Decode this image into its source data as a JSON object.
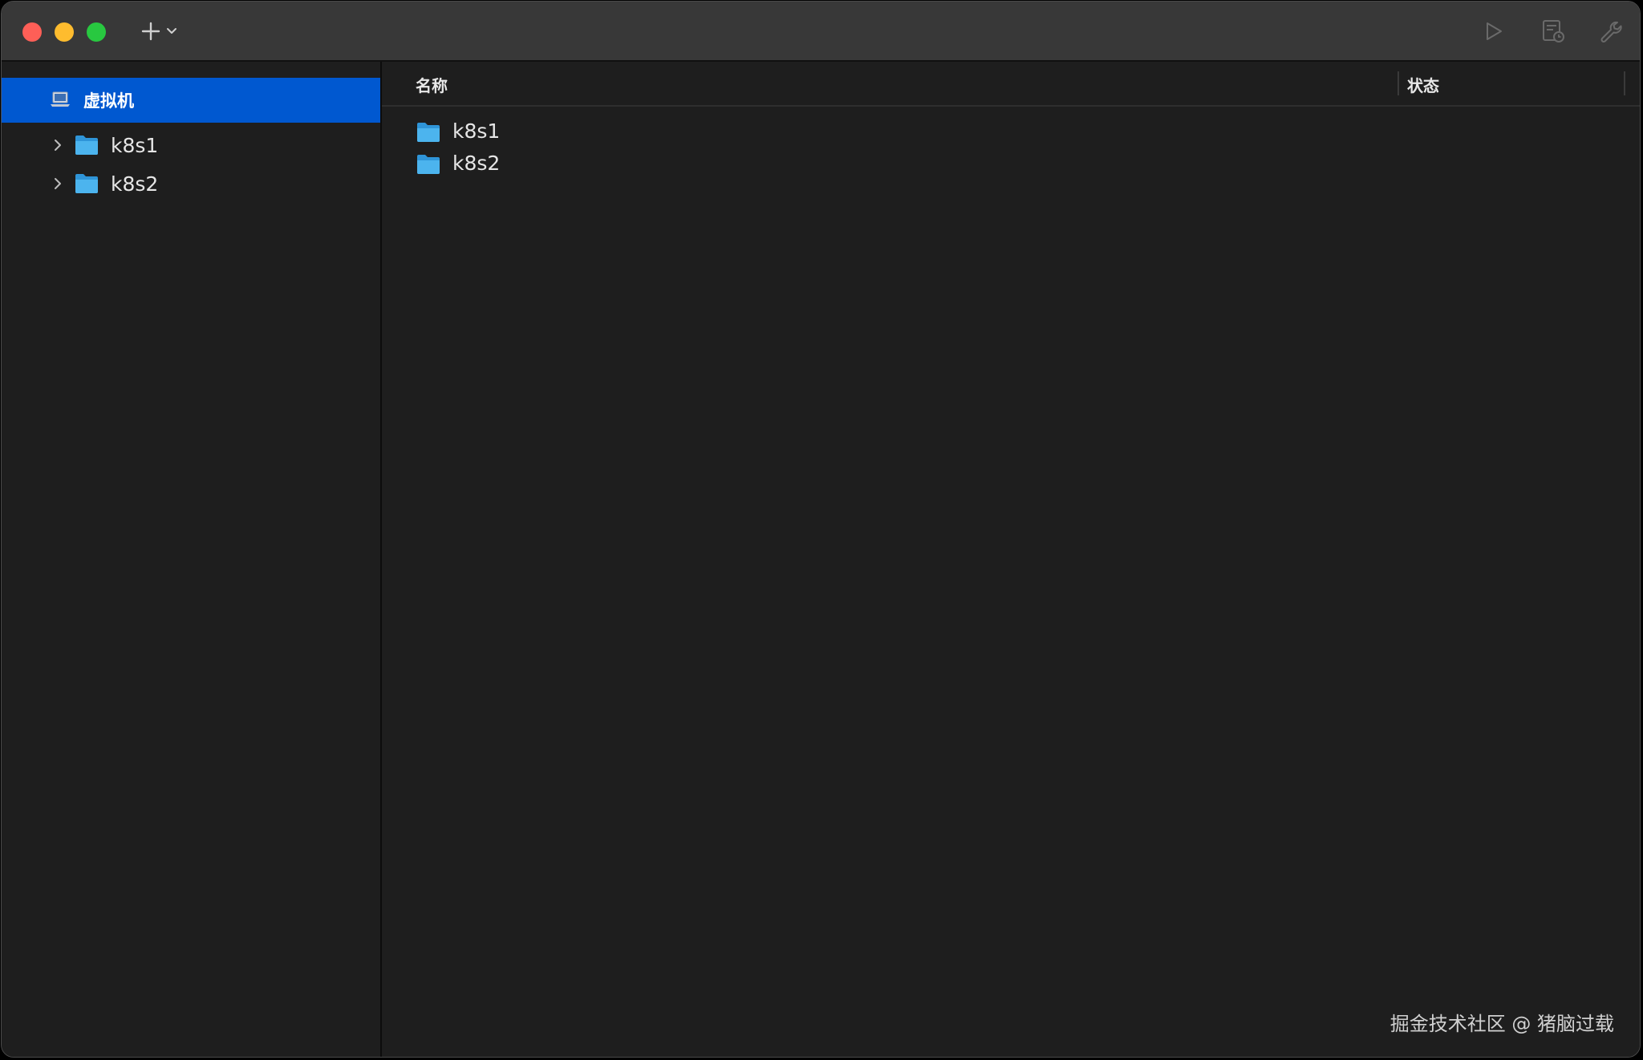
{
  "toolbar": {
    "add_icon": "plus-icon",
    "add_dropdown_icon": "chevron-down-icon",
    "start_icon": "play-icon",
    "snapshot_icon": "snapshot-icon",
    "settings_icon": "wrench-icon"
  },
  "sidebar": {
    "root": {
      "label": "虚拟机",
      "icon": "laptop-icon"
    },
    "items": [
      {
        "label": "k8s1",
        "icon": "folder-icon"
      },
      {
        "label": "k8s2",
        "icon": "folder-icon"
      }
    ]
  },
  "main": {
    "columns": {
      "name": "名称",
      "status": "状态"
    },
    "rows": [
      {
        "name": "k8s1",
        "status": ""
      },
      {
        "name": "k8s2",
        "status": ""
      }
    ]
  },
  "watermark": "掘金技术社区 @ 猪脑过载",
  "colors": {
    "selection": "#0058d0",
    "folder": "#4cb4ee",
    "close": "#fe5f57",
    "minimize": "#febc2e",
    "maximize": "#28c840"
  }
}
